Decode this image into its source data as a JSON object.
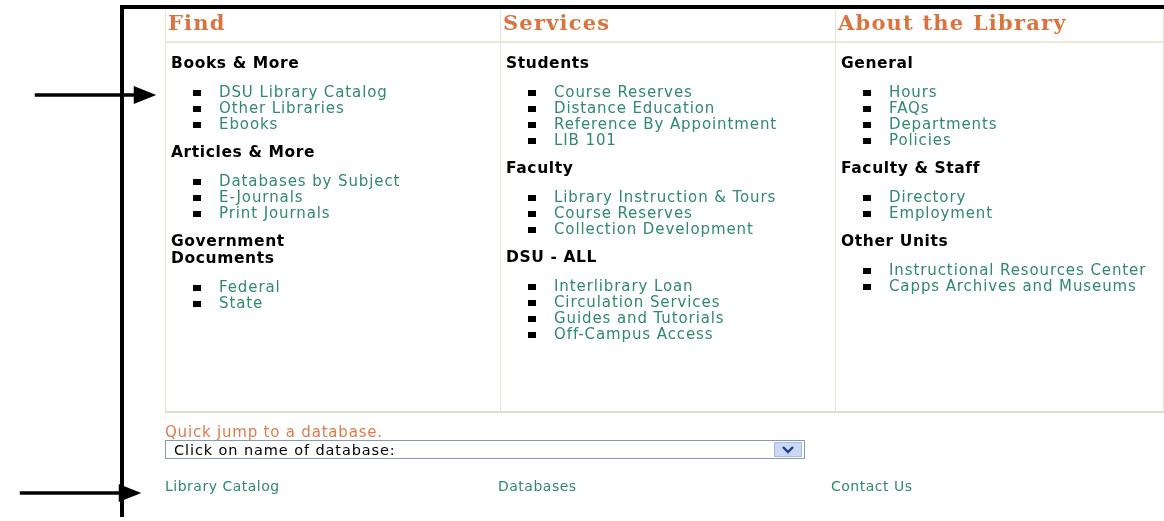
{
  "columns": [
    {
      "title": "Find",
      "sections": [
        {
          "heading": "Books & More",
          "links": [
            "DSU Library Catalog",
            "Other Libraries",
            "Ebooks"
          ]
        },
        {
          "heading": "Articles & More",
          "links": [
            "Databases by Subject",
            "E-Journals",
            "Print Journals"
          ]
        },
        {
          "heading": "Government Documents",
          "links": [
            "Federal",
            "State"
          ]
        }
      ]
    },
    {
      "title": "Services",
      "sections": [
        {
          "heading": "Students",
          "links": [
            "Course Reserves",
            "Distance Education",
            "Reference By Appointment",
            "LIB 101"
          ]
        },
        {
          "heading": "Faculty",
          "links": [
            "Library Instruction & Tours",
            "Course Reserves",
            "Collection Development"
          ]
        },
        {
          "heading": "DSU - ALL",
          "links": [
            "Interlibrary Loan",
            "Circulation Services",
            "Guides and Tutorials",
            "Off-Campus Access"
          ]
        }
      ]
    },
    {
      "title": "About the Library",
      "sections": [
        {
          "heading": "General",
          "links": [
            "Hours",
            "FAQs",
            "Departments",
            "Policies"
          ]
        },
        {
          "heading": "Faculty & Staff",
          "links": [
            "Directory",
            "Employment"
          ]
        },
        {
          "heading": "Other Units",
          "links": [
            "Instructional Resources Center",
            "Capps Archives and Museums"
          ]
        }
      ]
    }
  ],
  "quick_jump": {
    "label": "Quick jump to a database.",
    "value": "Click on name of database:"
  },
  "footer_links": [
    "Library Catalog",
    "Databases",
    "Contact Us"
  ]
}
